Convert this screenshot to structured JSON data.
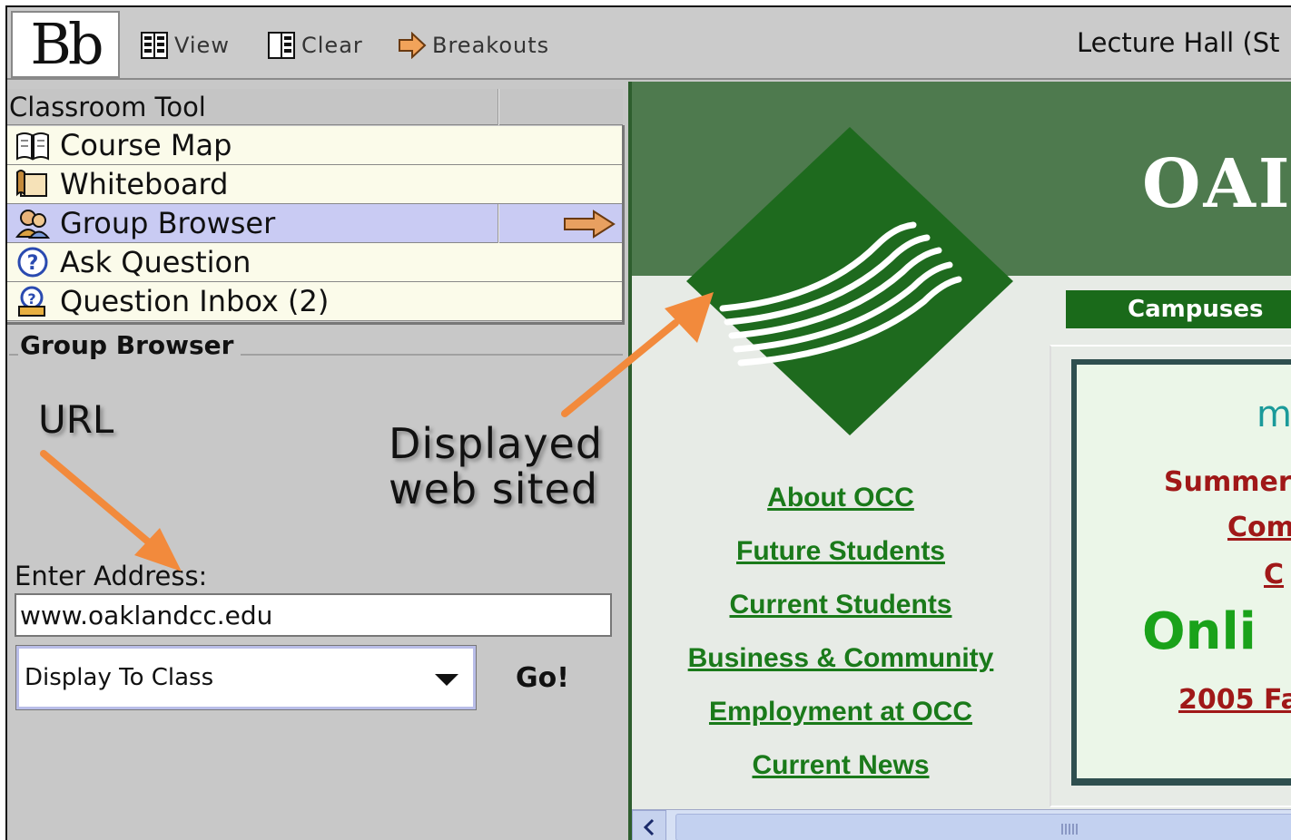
{
  "toolbar": {
    "logo_text": "Bb",
    "view_label": "View",
    "clear_label": "Clear",
    "breakouts_label": "Breakouts",
    "room_title": "Lecture Hall (St"
  },
  "classroom_tool": {
    "header": "Classroom Tool",
    "items": [
      {
        "label": "Course Map",
        "icon": "book-icon",
        "selected": false
      },
      {
        "label": "Whiteboard",
        "icon": "whiteboard-icon",
        "selected": false
      },
      {
        "label": "Group Browser",
        "icon": "people-icon",
        "selected": true
      },
      {
        "label": "Ask Question",
        "icon": "question-icon",
        "selected": false
      },
      {
        "label": "Question Inbox (2)",
        "icon": "inbox-icon",
        "selected": false
      }
    ]
  },
  "group_browser": {
    "legend": "Group Browser",
    "address_label": "Enter Address:",
    "address_value": "www.oaklandcc.edu",
    "display_option": "Display To Class",
    "go_label": "Go!"
  },
  "annotations": {
    "url": "URL",
    "displayed_line1": "Displayed",
    "displayed_line2": "web sited",
    "arrow_color": "#f28a3c"
  },
  "website": {
    "title_partial": "OAI",
    "campuses_label": "Campuses",
    "nav_links": [
      "About OCC",
      "Future Students",
      "Current Students",
      "Business & Community",
      "Employment at OCC",
      "Current News"
    ],
    "news_box": {
      "m": "m",
      "summer": "Summer",
      "com": "Com",
      "c": "C",
      "onli": "Onli",
      "year": "2005 Fa"
    },
    "colors": {
      "band_green": "#4e7a4e",
      "logo_green": "#1e6a1e",
      "link_green": "#1a7a1a",
      "accent_red": "#a01818"
    }
  }
}
